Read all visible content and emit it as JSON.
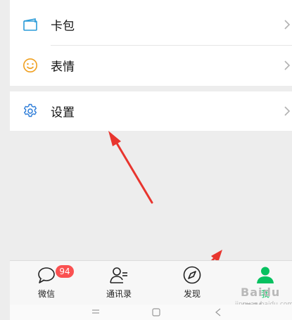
{
  "menu": {
    "items": [
      {
        "label": "卡包",
        "icon": "card-wallet-icon"
      },
      {
        "label": "表情",
        "icon": "smiley-icon"
      },
      {
        "label": "设置",
        "icon": "gear-icon"
      }
    ]
  },
  "tabbar": {
    "tabs": [
      {
        "label": "微信",
        "icon": "chat-bubble-icon",
        "badge": "94"
      },
      {
        "label": "通讯录",
        "icon": "contacts-icon"
      },
      {
        "label": "发现",
        "icon": "compass-icon"
      },
      {
        "label": "我",
        "icon": "person-icon",
        "active": true
      }
    ]
  },
  "system_nav": {
    "icons": [
      "menu-icon",
      "home-icon",
      "back-icon"
    ]
  },
  "colors": {
    "background": "#ededed",
    "accent_green": "#07c160",
    "badge_red": "#fa5151",
    "annotation_red": "#e8352e"
  },
  "watermark": {
    "text": "Baidu 经验",
    "subtext": "jingyan.baidu.com"
  }
}
